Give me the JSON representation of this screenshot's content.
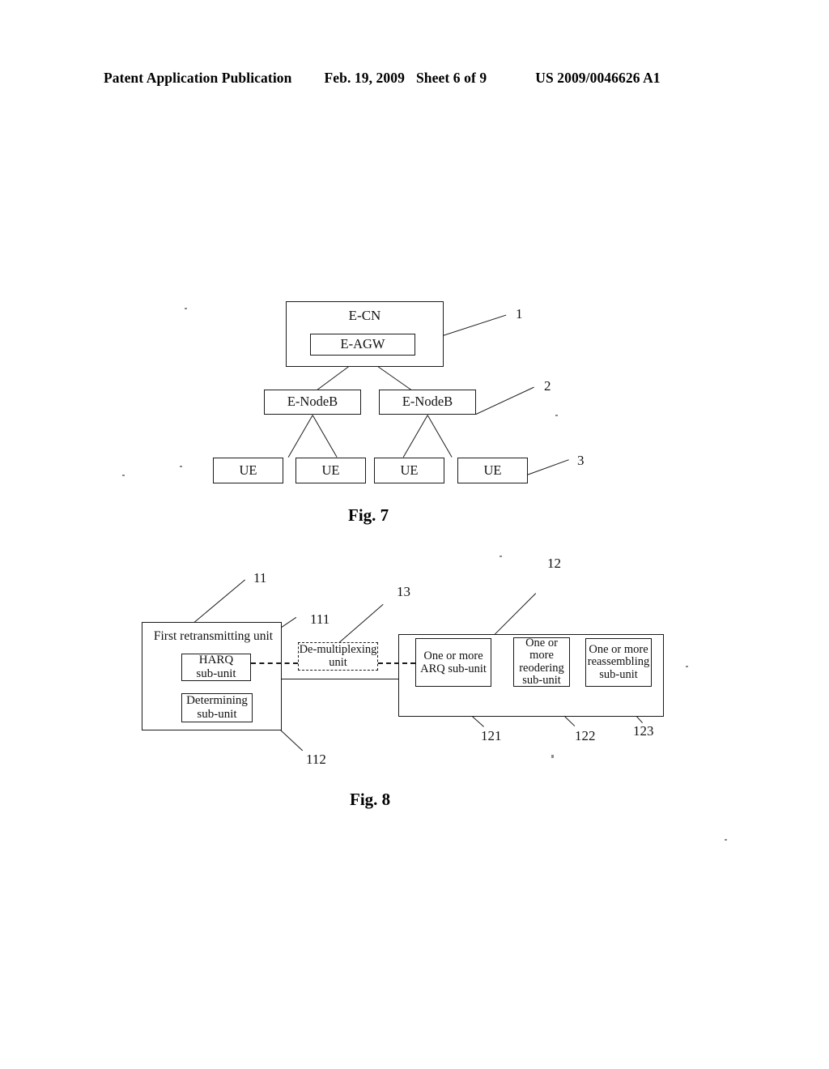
{
  "header": {
    "publication": "Patent Application Publication",
    "date": "Feb. 19, 2009",
    "sheet": "Sheet 6 of 9",
    "patent_number": "US 2009/0046626 A1"
  },
  "figures": [
    {
      "caption": "Fig. 7",
      "nodes": {
        "e_cn": "E-CN",
        "e_agw": "E-AGW",
        "enodeb_left": "E-NodeB",
        "enodeb_right": "E-NodeB",
        "ue_1": "UE",
        "ue_2": "UE",
        "ue_3": "UE",
        "ue_4": "UE"
      },
      "ref_numbers": {
        "core_network": "1",
        "base_station": "2",
        "user_equipment": "3"
      }
    },
    {
      "caption": "Fig. 8",
      "nodes": {
        "first_retransmitting_unit": "First retransmitting unit",
        "harq_sub_unit": "HARQ\nsub-unit",
        "harq_sub_unit_line1": "HARQ",
        "harq_sub_unit_line2": "sub-unit",
        "determining_sub_unit_line1": "Determining",
        "determining_sub_unit_line2": "sub-unit",
        "demultiplexing_unit_line1": "De-multiplexing",
        "demultiplexing_unit_line2": "unit",
        "arq_sub_unit_line1": "One or more",
        "arq_sub_unit_line2": "ARQ sub-unit",
        "reodering_sub_unit_line1": "One or",
        "reodering_sub_unit_line2": "more",
        "reodering_sub_unit_line3": "reodering",
        "reodering_sub_unit_line4": "sub-unit",
        "reassembling_sub_unit_line1": "One or more",
        "reassembling_sub_unit_line2": "reassembling",
        "reassembling_sub_unit_line3": "sub-unit"
      },
      "ref_numbers": {
        "first_retransmitting_unit": "11",
        "harq_sub_unit": "111",
        "determining_sub_unit": "112",
        "demultiplexing_unit": "13",
        "second_unit": "12",
        "arq_sub_unit": "121",
        "reodering_sub_unit": "122",
        "reassembling_sub_unit": "123"
      }
    }
  ],
  "colors": {
    "ink": "#1a1a1a",
    "paper": "#ffffff"
  }
}
